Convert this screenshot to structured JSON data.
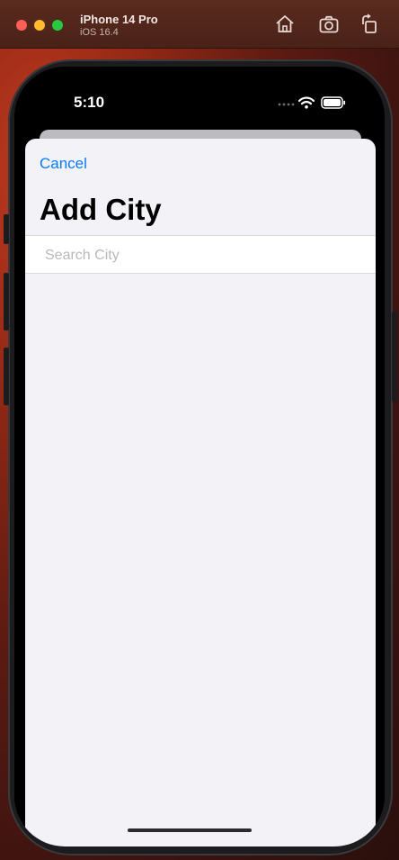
{
  "window": {
    "device_name": "iPhone 14 Pro",
    "os_version": "iOS 16.4",
    "toolbar_icons": [
      "home-icon",
      "screenshot-icon",
      "rotate-icon"
    ]
  },
  "status_bar": {
    "time": "5:10",
    "icons": [
      "wifi-icon",
      "battery-icon"
    ]
  },
  "sheet": {
    "cancel_label": "Cancel",
    "title": "Add City",
    "search": {
      "placeholder": "Search City",
      "value": ""
    }
  },
  "colors": {
    "accent": "#0a7aff",
    "sheet_background": "#f2f2f7"
  }
}
